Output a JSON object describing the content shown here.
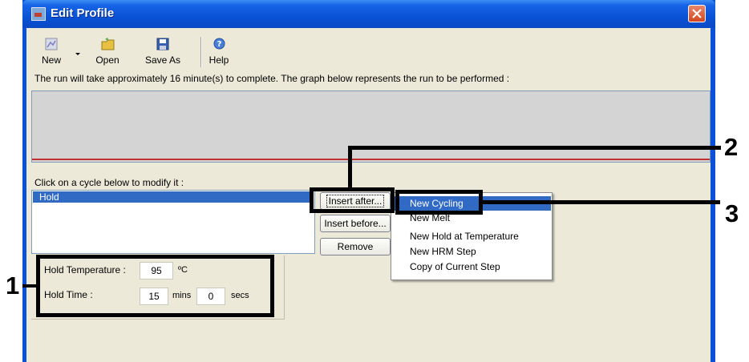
{
  "window": {
    "title": "Edit Profile",
    "titlebar_color": "#0a52d6",
    "close_color": "#d2461f"
  },
  "toolbar": {
    "new_label": "New",
    "open_label": "Open",
    "save_as_label": "Save As",
    "help_label": "Help",
    "icons": [
      "new-profile-icon",
      "open-folder-icon",
      "floppy-disk-icon",
      "help-icon"
    ]
  },
  "run_info": "The run will take approximately 16 minute(s) to complete. The graph below represents the run to be performed :",
  "cycle_section": {
    "label": "Click on a cycle below to modify it :",
    "items": [
      "Hold"
    ],
    "selected_color": "#316ac5"
  },
  "buttons": {
    "insert_after": "Insert after...",
    "insert_before": "Insert before...",
    "remove": "Remove"
  },
  "menu": {
    "items": [
      "New Cycling",
      "New Melt",
      "New Hold at Temperature",
      "New HRM Step",
      "Copy of Current Step"
    ],
    "selected": "New Cycling"
  },
  "hold": {
    "temperature_label": "Hold Temperature :",
    "temperature_value": "95",
    "temperature_unit": "ºC",
    "time_label": "Hold Time :",
    "minutes_value": "15",
    "minutes_unit": "mins",
    "seconds_value": "0",
    "seconds_unit": "secs"
  },
  "callouts": [
    "1",
    "2",
    "3"
  ]
}
